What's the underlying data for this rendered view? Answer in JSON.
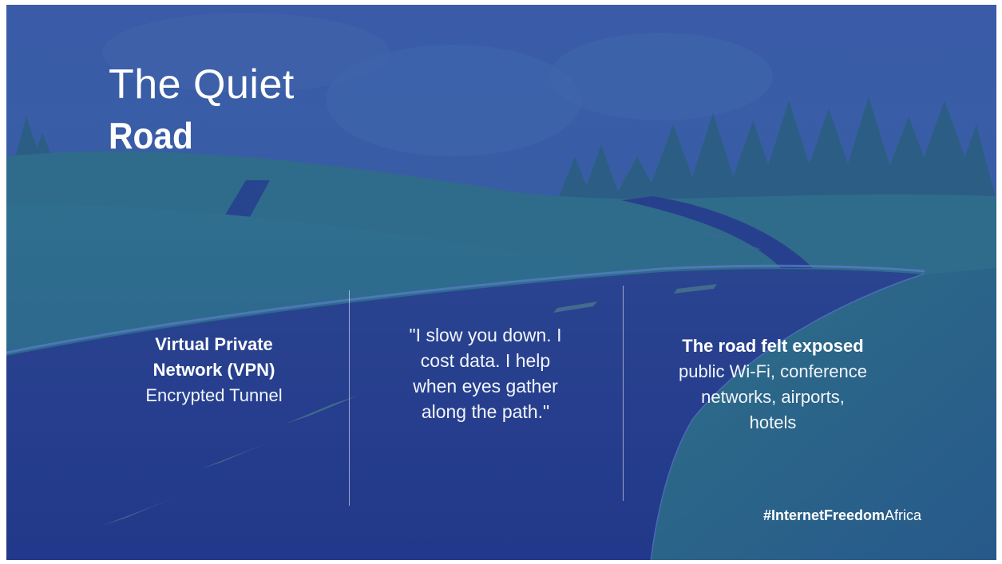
{
  "slide": {
    "title_line1": "The Quiet",
    "title_line2": "Road"
  },
  "columns": [
    {
      "heading_lines": [
        "Virtual Private",
        "Network (VPN)"
      ],
      "body_lines": [
        "Encrypted Tunnel"
      ]
    },
    {
      "quote_lines": [
        "\"I slow you down. I",
        "cost data. I help",
        "when eyes gather",
        "along the path.\""
      ]
    },
    {
      "heading": "The road felt exposed",
      "body_lines": [
        "public Wi-Fi, conference",
        "networks, airports,",
        "hotels"
      ]
    }
  ],
  "footer": {
    "hashtag_prefix": "#",
    "hashtag_bold": "InternetFreedom",
    "hashtag_suffix": "Africa"
  },
  "colors": {
    "sky": "#3a5fa8",
    "hills": "#2f7a8e",
    "road": "#233a8a",
    "trees": "#2a5c7a"
  }
}
